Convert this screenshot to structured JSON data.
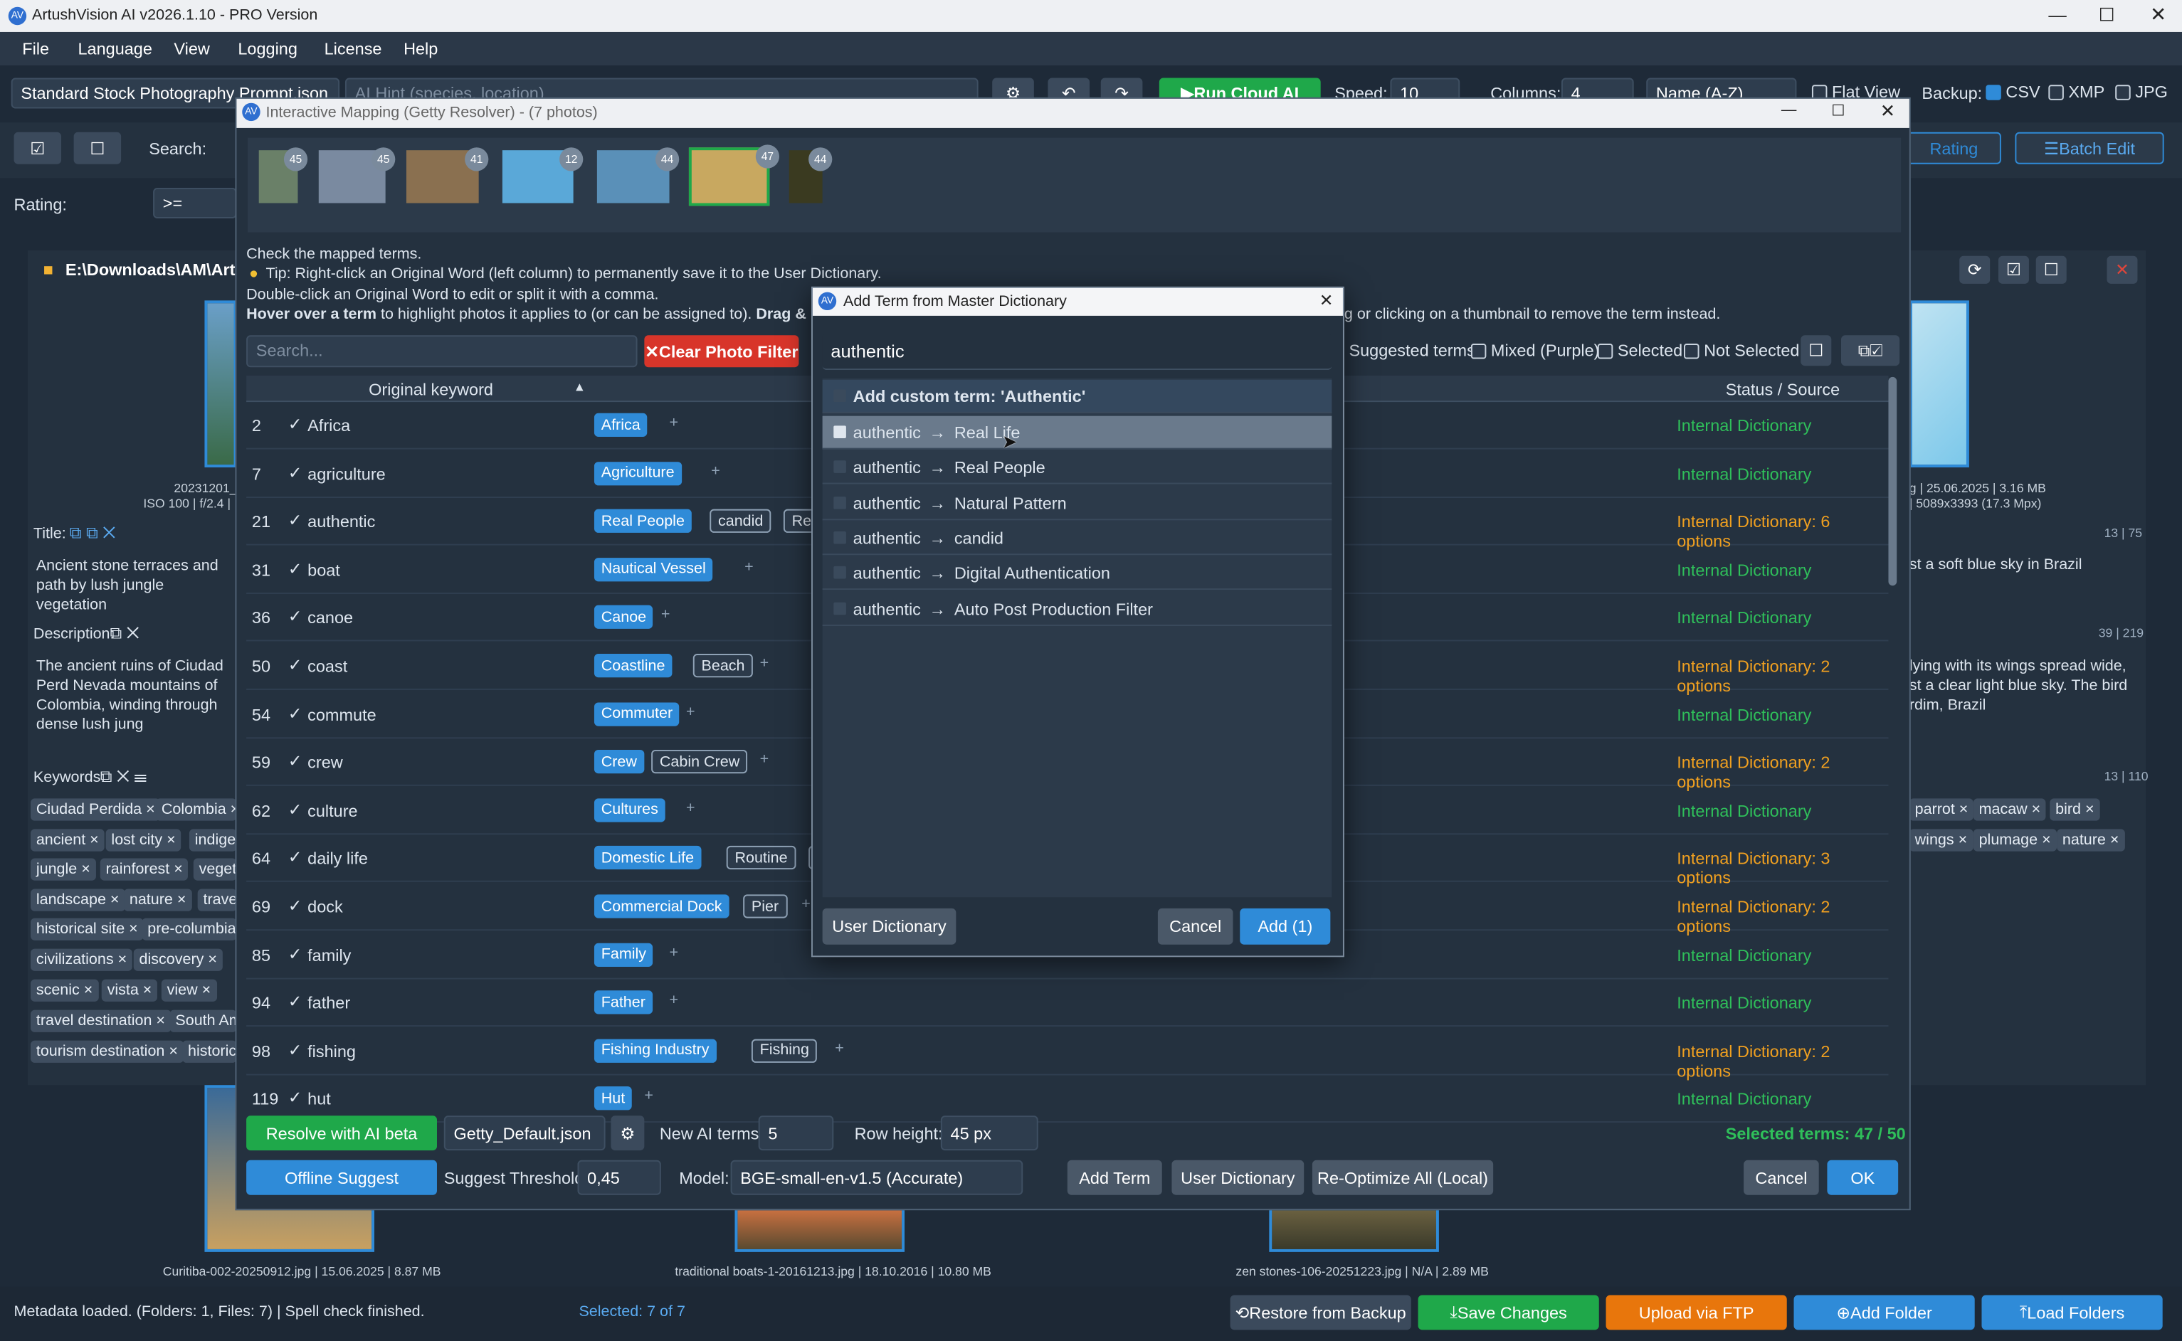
{
  "app": {
    "title": "ArtushVision AI v2026.1.10 - PRO Version",
    "menu": [
      "File",
      "Language",
      "View",
      "Logging",
      "License",
      "Help"
    ]
  },
  "toolbar": {
    "prompt_file": "Standard Stock Photography Prompt.json",
    "ai_hint": "AI Hint (species, location)",
    "run_label": "Run Cloud AI",
    "speed_label": "Speed:",
    "speed_value": "10",
    "columns_label": "Columns:",
    "columns_value": "4",
    "sort_value": "Name (A-Z)",
    "flat_view": "Flat View",
    "backup_label": "Backup:",
    "csv": "CSV",
    "xmp": "XMP",
    "jpg": "JPG",
    "search_label": "Search:",
    "rating_btn": "Rating",
    "batch_edit": "Batch Edit",
    "rating_label": "Rating:",
    "rating_op": ">="
  },
  "left": {
    "path": "E:\\Downloads\\AM\\Artu",
    "img_caption1": "20231201_(",
    "img_caption2": "ISO 100 | f/2.4 |",
    "title_label": "Title:",
    "title_text": "Ancient stone terraces and path by lush jungle vegetation",
    "desc_label": "Description:",
    "desc_text": "The ancient ruins of Ciudad Perd Nevada mountains of Colombia, winding through dense lush jung",
    "kw_label": "Keywords:",
    "keywords": [
      "Ciudad Perdida",
      "Colombia",
      "ancient",
      "lost city",
      "indige",
      "jungle",
      "rainforest",
      "veget",
      "landscape",
      "nature",
      "trave",
      "historical site",
      "pre-columbia",
      "civilizations",
      "discovery",
      "scenic",
      "vista",
      "view",
      "travel destination",
      "South Am",
      "tourism destination",
      "historic"
    ]
  },
  "right": {
    "meta1": "g | 25.06.2025 | 3.16 MB",
    "meta2": "| 5089x3393 (17.3 Mpx)",
    "count1": "13 | 75",
    "title_text": "st a soft blue sky in Brazil",
    "count2": "39 | 219",
    "desc_text": "lying with its wings spread wide, st a clear light blue sky. The bird rdim, Brazil",
    "count3": "13 | 110",
    "keywords": [
      "parrot",
      "macaw",
      "bird",
      "wings",
      "plumage",
      "nature"
    ]
  },
  "bottom_strip": {
    "cap1": "Curitiba-002-20250912.jpg | 15.06.2025 | 8.87 MB",
    "cap2": "traditional boats-1-20161213.jpg | 18.10.2016 | 10.80 MB",
    "cap3": "zen stones-106-20251223.jpg | N/A | 2.89 MB"
  },
  "status": {
    "text": "Metadata loaded. (Folders: 1, Files: 7) | Spell check finished.",
    "selected": "Selected: 7 of 7",
    "restore": "Restore from Backup",
    "save": "Save Changes",
    "ftp": "Upload via FTP",
    "add_folder": "Add Folder",
    "load_folders": "Load Folders"
  },
  "mapping": {
    "title": "Interactive Mapping (Getty Resolver) - (7 photos)",
    "thumb_counts": [
      "45",
      "45",
      "41",
      "12",
      "44",
      "47",
      "44"
    ],
    "help1": "Check the mapped terms.",
    "help2": "Tip: Right-click an Original Word (left column) to permanently save it to the User Dictionary.",
    "help3": "Double-click an Original Word to edit or split it with a comma.",
    "help4_bold": "Hover over a term",
    "help4": "to highlight photos it applies to (or can be assigned to).",
    "help4_bold2": "Drag & D",
    "help4_tail": "g or clicking on a thumbnail to remove the term instead.",
    "search_placeholder": "Search...",
    "clear_filter": "Clear Photo Filter",
    "suggested": "Suggested terms",
    "mixed": "Mixed (Purple)",
    "selected": "Selected",
    "not_selected": "Not Selected",
    "col_original": "Original keyword",
    "col_status": "Status / Source",
    "rows": [
      {
        "num": "2",
        "kw": "Africa",
        "status": "Internal Dictionary",
        "tags": [
          {
            "t": "Africa",
            "s": "blue"
          }
        ]
      },
      {
        "num": "7",
        "kw": "agriculture",
        "status": "Internal Dictionary",
        "tags": [
          {
            "t": "Agriculture",
            "s": "blue"
          }
        ]
      },
      {
        "num": "21",
        "kw": "authentic",
        "status": "Internal Dictionary: 6 options",
        "tags": [
          {
            "t": "Real People",
            "s": "blue"
          },
          {
            "t": "candid",
            "s": "out"
          },
          {
            "t": "Real Life",
            "s": "out"
          }
        ]
      },
      {
        "num": "31",
        "kw": "boat",
        "status": "Internal Dictionary",
        "tags": [
          {
            "t": "Nautical Vessel",
            "s": "blue"
          }
        ]
      },
      {
        "num": "36",
        "kw": "canoe",
        "status": "Internal Dictionary",
        "tags": [
          {
            "t": "Canoe",
            "s": "blue"
          }
        ]
      },
      {
        "num": "50",
        "kw": "coast",
        "status": "Internal Dictionary: 2 options",
        "tags": [
          {
            "t": "Coastline",
            "s": "blue"
          },
          {
            "t": "Beach",
            "s": "out"
          }
        ]
      },
      {
        "num": "54",
        "kw": "commute",
        "status": "Internal Dictionary",
        "tags": [
          {
            "t": "Commuter",
            "s": "blue"
          }
        ]
      },
      {
        "num": "59",
        "kw": "crew",
        "status": "Internal Dictionary: 2 options",
        "tags": [
          {
            "t": "Crew",
            "s": "blue"
          },
          {
            "t": "Cabin Crew",
            "s": "out"
          }
        ]
      },
      {
        "num": "62",
        "kw": "culture",
        "status": "Internal Dictionary",
        "tags": [
          {
            "t": "Cultures",
            "s": "blue"
          }
        ]
      },
      {
        "num": "64",
        "kw": "daily life",
        "status": "Internal Dictionary: 3 options",
        "tags": [
          {
            "t": "Domestic Life",
            "s": "blue"
          },
          {
            "t": "Routine",
            "s": "out"
          },
          {
            "t": "Lifest",
            "s": "out"
          }
        ]
      },
      {
        "num": "69",
        "kw": "dock",
        "status": "Internal Dictionary: 2 options",
        "tags": [
          {
            "t": "Commercial Dock",
            "s": "blue"
          },
          {
            "t": "Pier",
            "s": "out"
          }
        ]
      },
      {
        "num": "85",
        "kw": "family",
        "status": "Internal Dictionary",
        "tags": [
          {
            "t": "Family",
            "s": "blue"
          }
        ]
      },
      {
        "num": "94",
        "kw": "father",
        "status": "Internal Dictionary",
        "tags": [
          {
            "t": "Father",
            "s": "blue"
          }
        ]
      },
      {
        "num": "98",
        "kw": "fishing",
        "status": "Internal Dictionary: 2 options",
        "tags": [
          {
            "t": "Fishing Industry",
            "s": "blue"
          },
          {
            "t": "Fishing",
            "s": "out"
          }
        ]
      },
      {
        "num": "119",
        "kw": "hut",
        "status": "Internal Dictionary",
        "tags": [
          {
            "t": "Hut",
            "s": "blue"
          }
        ]
      }
    ],
    "resolve_ai": "Resolve with AI beta",
    "profile": "Getty_Default.json",
    "new_ai_label": "New AI terms:",
    "new_ai_value": "5",
    "row_height_label": "Row height:",
    "row_height_value": "45 px",
    "selected_terms": "Selected terms: 47 / 50",
    "offline": "Offline Suggest",
    "threshold_label": "Suggest Threshold:",
    "threshold_value": "0,45",
    "model_label": "Model:",
    "model_value": "BGE-small-en-v1.5 (Accurate)",
    "add_term": "Add Term",
    "user_dict": "User Dictionary",
    "reoptimize": "Re-Optimize All (Local)",
    "cancel": "Cancel",
    "ok": "OK"
  },
  "dialog": {
    "title": "Add Term from Master Dictionary",
    "search": "authentic",
    "custom": "Add custom term: 'Authentic'",
    "options": [
      {
        "src": "authentic",
        "dst": "Real Life",
        "checked": true
      },
      {
        "src": "authentic",
        "dst": "Real People",
        "checked": false
      },
      {
        "src": "authentic",
        "dst": "Natural Pattern",
        "checked": false
      },
      {
        "src": "authentic",
        "dst": "candid",
        "checked": false
      },
      {
        "src": "authentic",
        "dst": "Digital Authentication",
        "checked": false
      },
      {
        "src": "authentic",
        "dst": "Auto Post Production Filter",
        "checked": false
      }
    ],
    "user_dict": "User Dictionary",
    "cancel": "Cancel",
    "add": "Add (1)"
  },
  "colors": {
    "accent": "#2f8bd8",
    "green": "#1fa84a",
    "orange": "#e8860c",
    "status_green": "#2fbf5a",
    "status_orange": "#f0a020"
  }
}
